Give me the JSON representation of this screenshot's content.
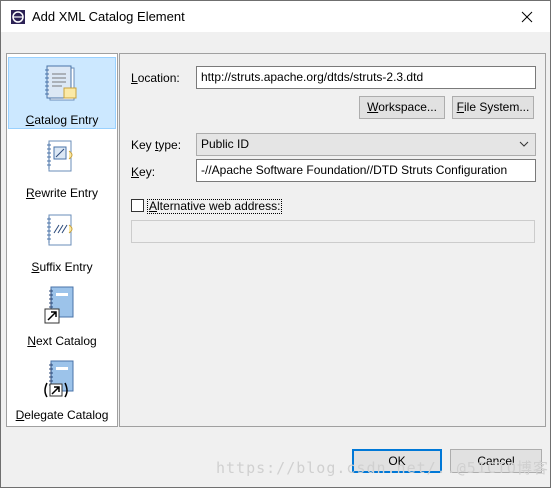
{
  "window": {
    "title": "Add XML Catalog Element"
  },
  "sidebar": {
    "items": [
      {
        "label": "Catalog Entry",
        "selected": true
      },
      {
        "label": "Rewrite Entry",
        "selected": false
      },
      {
        "label": "Suffix Entry",
        "selected": false
      },
      {
        "label": "Next Catalog",
        "selected": false
      },
      {
        "label": "Delegate Catalog",
        "selected": false
      }
    ]
  },
  "form": {
    "location_label": "Location:",
    "location_value": "http://struts.apache.org/dtds/struts-2.3.dtd",
    "workspace_button": "Workspace...",
    "filesystem_button": "File System...",
    "keytype_label": "Key type:",
    "keytype_value": "Public ID",
    "key_label": "Key:",
    "key_value": "-//Apache Software Foundation//DTD Struts Configuration",
    "alt_checkbox_label": "Alternative web address:",
    "alt_checked": false
  },
  "footer": {
    "ok_label": "OK",
    "cancel_label": "Cancel"
  },
  "watermark": {
    "text": "https://blog.csdn.net/..@51CTO博客"
  }
}
